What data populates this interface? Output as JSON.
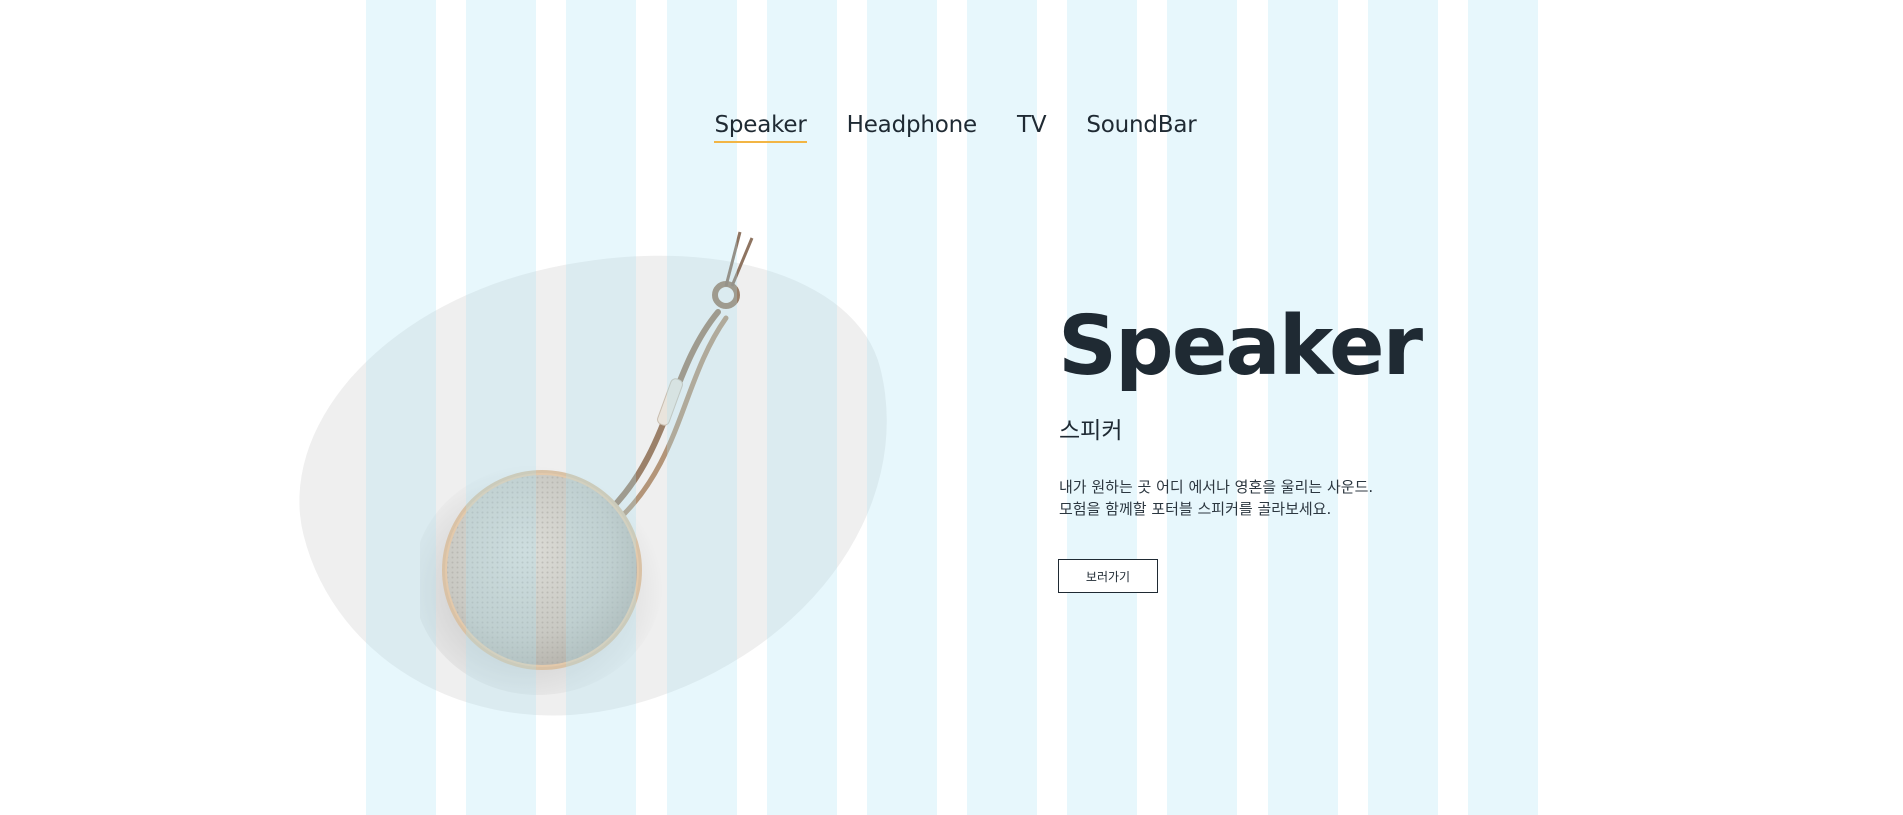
{
  "nav": {
    "items": [
      {
        "label": "Speaker",
        "active": true
      },
      {
        "label": "Headphone",
        "active": false
      },
      {
        "label": "TV",
        "active": false
      },
      {
        "label": "SoundBar",
        "active": false
      }
    ],
    "active_underline_color": "#f2b544"
  },
  "hero": {
    "title": "Speaker",
    "subtitle": "스피커",
    "description_line1": "내가 원하는 곳 어디 에서나 영혼을 울리는 사운드.",
    "description_line2": "모험을 함께할 포터블 스피커를 골라보세요.",
    "button_label": "보러가기"
  },
  "product": {
    "icon": "portable-speaker-image"
  },
  "colors": {
    "text": "#1f2a33",
    "blob": "#efefef",
    "grid_overlay": "#aae1f5"
  }
}
